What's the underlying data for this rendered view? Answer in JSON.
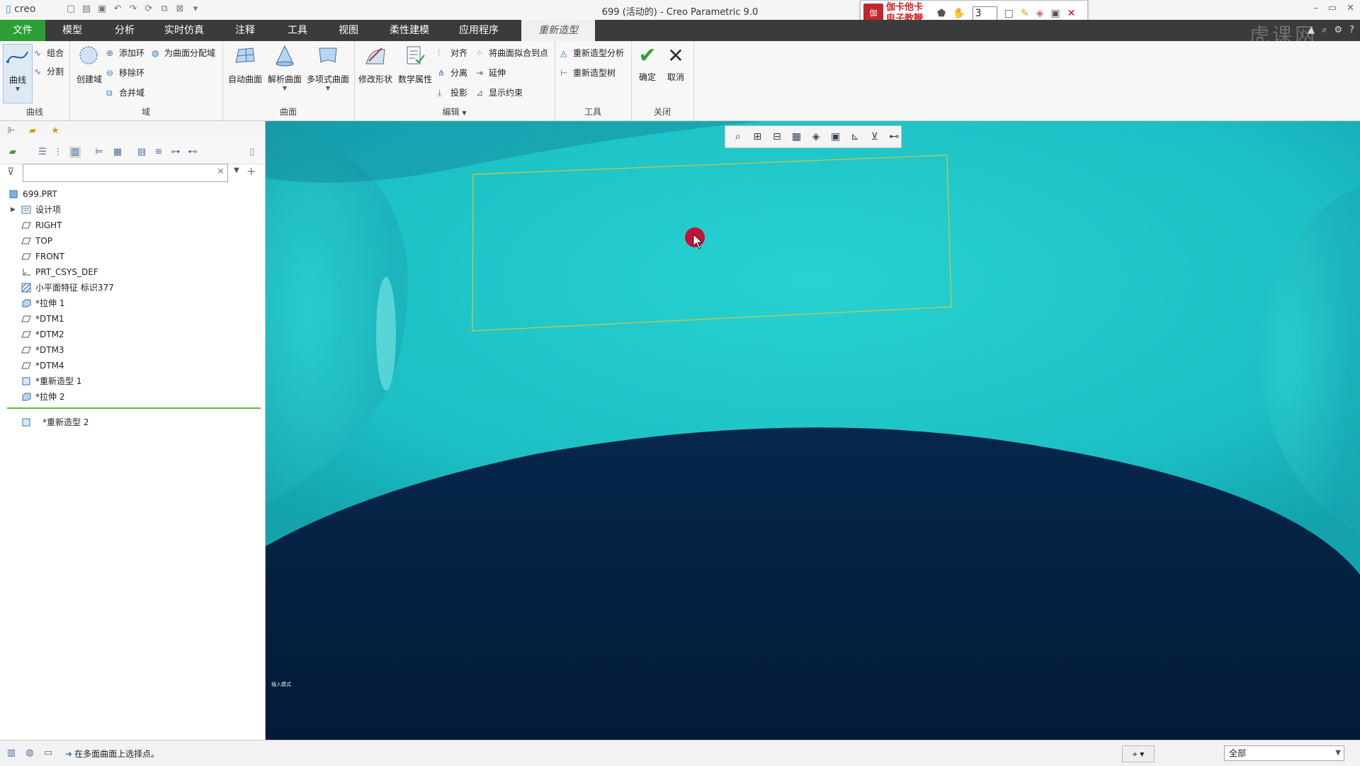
{
  "app": {
    "logo_text": "creo",
    "window_title": "699 (活动的) - Creo Parametric 9.0",
    "watermark": "虎课网"
  },
  "teach_toolbar": {
    "badge": "伽",
    "name_line1": "伽卡他卡",
    "name_line2": "电子教鞭",
    "spin_value": "3"
  },
  "tabs": [
    {
      "label": "文件"
    },
    {
      "label": "模型"
    },
    {
      "label": "分析"
    },
    {
      "label": "实时仿真"
    },
    {
      "label": "注释"
    },
    {
      "label": "工具"
    },
    {
      "label": "视图"
    },
    {
      "label": "柔性建模"
    },
    {
      "label": "应用程序"
    },
    {
      "label": "重新造型"
    }
  ],
  "ribbon": {
    "curves": {
      "big": "曲线",
      "combine": "组合",
      "split": "分割",
      "group": "曲线"
    },
    "domain": {
      "create": "创建域",
      "add_loop": "添加环",
      "remove_loop": "移除环",
      "merge": "合并域",
      "assign": "为曲面分配域",
      "group": "域"
    },
    "surface": {
      "auto": "自动曲面",
      "analytic": "解析曲面",
      "polyface": "多项式曲面",
      "group": "曲面"
    },
    "edit": {
      "modify_shape": "修改形状",
      "math_props": "数学属性",
      "align": "对齐",
      "fit_points": "将曲面拟合到点",
      "separate": "分离",
      "extend": "延伸",
      "project": "投影",
      "show_constraints": "显示约束",
      "group": "编辑"
    },
    "tools": {
      "analysis": "重新造型分析",
      "tree": "重新造型树",
      "group": "工具"
    },
    "close": {
      "ok": "确定",
      "cancel": "取消",
      "group": "关闭"
    }
  },
  "tree": {
    "items": [
      {
        "label": "699.PRT",
        "icon": "part-icon"
      },
      {
        "label": "设计项",
        "icon": "design-items-icon",
        "expand": "▶"
      },
      {
        "label": "RIGHT",
        "icon": "datum-plane-icon"
      },
      {
        "label": "TOP",
        "icon": "datum-plane-icon"
      },
      {
        "label": "FRONT",
        "icon": "datum-plane-icon"
      },
      {
        "label": "PRT_CSYS_DEF",
        "icon": "csys-icon"
      },
      {
        "label": "小平面特征 标识377",
        "icon": "facet-feature-icon"
      },
      {
        "label": "*拉伸 1",
        "icon": "extrude-icon"
      },
      {
        "label": "*DTM1",
        "icon": "datum-plane-icon"
      },
      {
        "label": "*DTM2",
        "icon": "datum-plane-icon"
      },
      {
        "label": "*DTM3",
        "icon": "datum-plane-icon"
      },
      {
        "label": "*DTM4",
        "icon": "datum-plane-icon"
      },
      {
        "label": "*重新造型 1",
        "icon": "restyle-icon"
      },
      {
        "label": "*拉伸 2",
        "icon": "extrude-icon"
      },
      {
        "label": "*重新造型 2",
        "icon": "restyle-icon"
      }
    ]
  },
  "viewport": {
    "corner_text": "插入模式",
    "surface_color": "#1fc7c7",
    "boundary_color": "#d4c63a",
    "pointer_color": "#c2123a"
  },
  "status": {
    "message": "在多面曲面上选择点。",
    "filter_value": "全部"
  }
}
